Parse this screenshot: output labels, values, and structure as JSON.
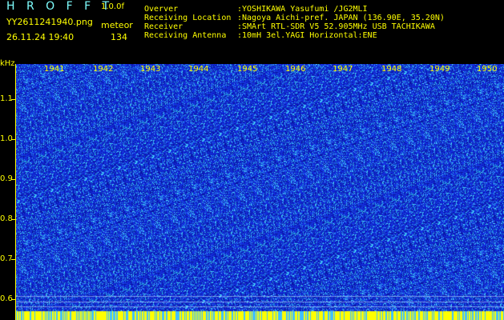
{
  "header": {
    "app_title": "H R O F F T",
    "app_version": "1.0.0f",
    "filename": "YY2611241940.png",
    "mode": "meteor",
    "datetime": "26.11.24 19:40",
    "count": "134"
  },
  "info": {
    "observer_label": "Overver",
    "observer_value": ":YOSHIKAWA Yasufumi /JG2MLI",
    "location_label": "Receiving Location",
    "location_value": ":Nagoya Aichi-pref. JAPAN (136.90E, 35.20N)",
    "receiver_label": "Receiver",
    "receiver_value": ":SMArt RTL-SDR V5 52.905MHz USB TACHIKAWA",
    "antenna_label": "Receiving Antenna",
    "antenna_value": ":10mH 3el.YAGI Horizontal:ENE"
  },
  "axis": {
    "y_unit": "kHz",
    "y_ticks": [
      "1.1",
      "1.0",
      "0.9",
      "0.8",
      "0.7",
      "0.6"
    ],
    "x_ticks": [
      "1941",
      "1942",
      "1943",
      "1944",
      "1945",
      "1946",
      "1947",
      "1948",
      "1949",
      "1950"
    ]
  },
  "colors": {
    "background": "#000000",
    "spectrogram_base": "#1a2fd8",
    "noise_light": "#4fd0ff",
    "text": "#ffff00",
    "title": "#7fffff",
    "baseline": "#ffff00"
  }
}
